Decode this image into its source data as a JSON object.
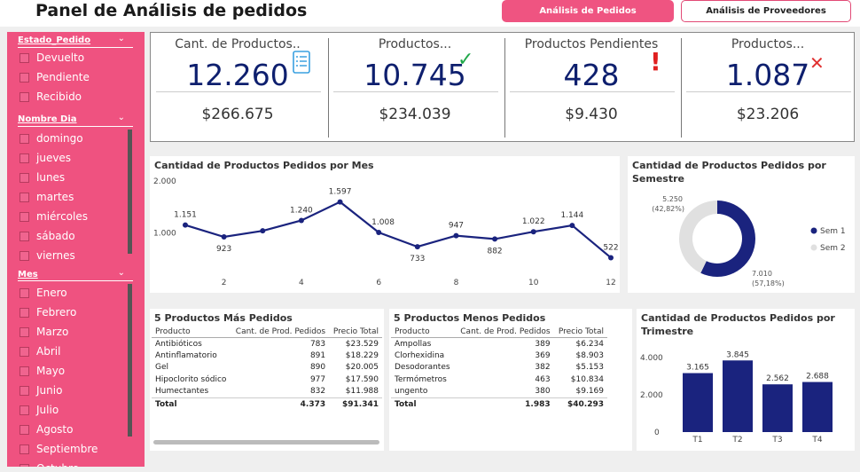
{
  "header": {
    "title": "Panel de Análisis de pedidos",
    "btn_active": "Análisis de Pedidos",
    "btn_inactive": "Análisis de Proveedores"
  },
  "slicers": {
    "estado": {
      "title": "Estado_Pedido",
      "items": [
        "Devuelto",
        "Pendiente",
        "Recibido"
      ]
    },
    "dia": {
      "title": "Nombre Dia",
      "items": [
        "domingo",
        "jueves",
        "lunes",
        "martes",
        "miércoles",
        "sábado",
        "viernes"
      ]
    },
    "mes": {
      "title": "Mes",
      "items": [
        "Enero",
        "Febrero",
        "Marzo",
        "Abril",
        "Mayo",
        "Junio",
        "Julio",
        "Agosto",
        "Septiembre",
        "Octubre"
      ]
    }
  },
  "kpis": [
    {
      "label": "Cant. de Productos..",
      "value": "12.260",
      "sub": "$266.675",
      "icon": "checklist-icon",
      "icon_char": "☷",
      "icon_color": "#3aa0e0"
    },
    {
      "label": "Productos...",
      "value": "10.745",
      "sub": "$234.039",
      "icon": "check-icon",
      "icon_char": "✓",
      "icon_color": "#1fa84a"
    },
    {
      "label": "Productos Pendientes",
      "value": "428",
      "sub": "$9.430",
      "icon": "exclamation-icon",
      "icon_char": "!",
      "icon_color": "#e02020"
    },
    {
      "label": "Productos...",
      "value": "1.087",
      "sub": "$23.206",
      "icon": "cross-icon",
      "icon_char": "✕",
      "icon_color": "#e03030"
    }
  ],
  "line_chart": {
    "title": "Cantidad de Productos Pedidos por Mes",
    "y_ticks": [
      "2.000",
      "1.000"
    ],
    "x_ticks": [
      "2",
      "4",
      "6",
      "8",
      "10",
      "12"
    ],
    "value_labels": [
      "1.151",
      "923",
      "1.240",
      "1.597",
      "1.008",
      "733",
      "947",
      "882",
      "1.022",
      "1.144",
      "522"
    ]
  },
  "donut_chart": {
    "title": "Cantidad de Productos Pedidos por Semestre",
    "label_1_value": "5.250",
    "label_1_pct": "(42,82%)",
    "label_2_value": "7.010",
    "label_2_pct": "(57,18%)",
    "legend_1": "Sem 1",
    "legend_2": "Sem 2"
  },
  "top5": {
    "title": "5 Productos Más Pedidos",
    "headers": [
      "Producto",
      "Cant. de Prod. Pedidos",
      "Precio Total"
    ],
    "rows": [
      [
        "Antibióticos",
        "783",
        "$23.529"
      ],
      [
        "Antinflamatorio",
        "891",
        "$18.229"
      ],
      [
        "Gel",
        "890",
        "$20.005"
      ],
      [
        "Hipoclorito sódico",
        "977",
        "$17.590"
      ],
      [
        "Humectantes",
        "832",
        "$11.988"
      ]
    ],
    "total": [
      "Total",
      "4.373",
      "$91.341"
    ]
  },
  "bottom5": {
    "title": "5 Productos Menos Pedidos",
    "headers": [
      "Producto",
      "Cant. de Prod. Pedidos",
      "Precio Total"
    ],
    "rows": [
      [
        "Ampollas",
        "389",
        "$6.234"
      ],
      [
        "Clorhexidina",
        "369",
        "$8.903"
      ],
      [
        "Desodorantes",
        "382",
        "$5.153"
      ],
      [
        "Termómetros",
        "463",
        "$10.834"
      ],
      [
        "ungento",
        "380",
        "$9.169"
      ]
    ],
    "total": [
      "Total",
      "1.983",
      "$40.293"
    ]
  },
  "bar_chart": {
    "title": "Cantidad de Productos Pedidos por Trimestre",
    "y_ticks": [
      "4.000",
      "2.000",
      "0"
    ],
    "value_labels": [
      "3.165",
      "3.845",
      "2.562",
      "2.688"
    ]
  },
  "chart_data": [
    {
      "type": "line",
      "title": "Cantidad de Productos Pedidos por Mes",
      "x": [
        1,
        2,
        3,
        4,
        5,
        6,
        7,
        8,
        9,
        10,
        11,
        12
      ],
      "values": [
        1151,
        923,
        1040,
        1240,
        1597,
        1008,
        733,
        947,
        882,
        1022,
        1144,
        522
      ],
      "ylim": [
        0,
        2000
      ],
      "color": "#1a237e"
    },
    {
      "type": "pie",
      "title": "Cantidad de Productos Pedidos por Semestre",
      "categories": [
        "Sem 1",
        "Sem 2"
      ],
      "values": [
        5250,
        7010
      ],
      "colors": [
        "#1a237e",
        "#e0e0e0"
      ]
    },
    {
      "type": "bar",
      "title": "Cantidad de Productos Pedidos por Trimestre",
      "categories": [
        "T1",
        "T2",
        "T3",
        "T4"
      ],
      "values": [
        3165,
        3845,
        2562,
        2688
      ],
      "ylim": [
        0,
        4000
      ],
      "color": "#1a237e"
    }
  ],
  "colors": {
    "accent": "#ef5280",
    "navy": "#0e1f6e"
  }
}
